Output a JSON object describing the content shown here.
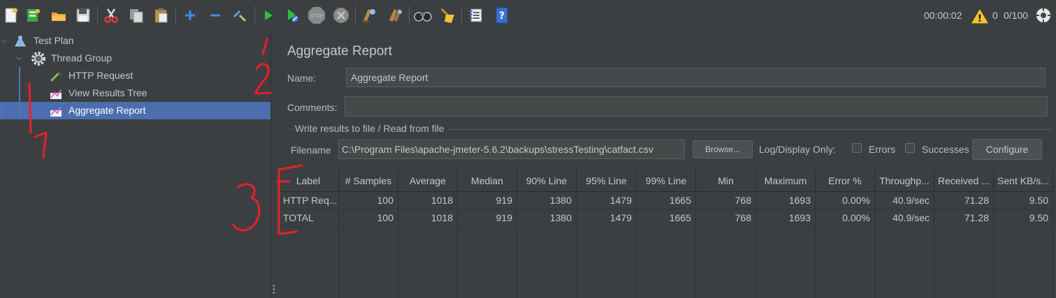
{
  "toolbar": {
    "icons": [
      "new-icon",
      "templates-icon",
      "open-icon",
      "save-icon",
      "cut-icon",
      "copy-icon",
      "paste-icon",
      "expand-icon",
      "collapse-icon",
      "toggle-icon",
      "start-icon",
      "start-no-pauses-icon",
      "stop-icon",
      "shutdown-icon",
      "clear-icon",
      "clear-all-icon",
      "search-icon",
      "reset-search-icon",
      "function-helper-icon",
      "help-icon"
    ],
    "elapsed": "00:00:02",
    "warning_count": "0",
    "threads": "0/100"
  },
  "tree": {
    "items": [
      {
        "label": "Test Plan"
      },
      {
        "label": "Thread Group"
      },
      {
        "label": "HTTP Request"
      },
      {
        "label": "View Results Tree"
      },
      {
        "label": "Aggregate Report"
      }
    ]
  },
  "panel": {
    "title": "Aggregate Report",
    "name_label": "Name:",
    "name_value": "Aggregate Report",
    "comments_label": "Comments:",
    "comments_value": "",
    "group_title": "Write results to file / Read from file",
    "filename_label": "Filename",
    "filename_value": "C:\\Program Files\\apache-jmeter-5.6.2\\backups\\stressTesting\\catfact.csv",
    "browse_label": "Browse...",
    "log_display_label": "Log/Display Only:",
    "errors_label": "Errors",
    "successes_label": "Successes",
    "configure_label": "Configure"
  },
  "table": {
    "headers": [
      "Label",
      "# Samples",
      "Average",
      "Median",
      "90% Line",
      "95% Line",
      "99% Line",
      "Min",
      "Maximum",
      "Error %",
      "Throughp...",
      "Received ...",
      "Sent KB/s..."
    ],
    "rows": [
      [
        "HTTP Req...",
        "100",
        "1018",
        "919",
        "1380",
        "1479",
        "1665",
        "768",
        "1693",
        "0.00%",
        "40.9/sec",
        "71.28",
        "9.50"
      ],
      [
        "TOTAL",
        "100",
        "1018",
        "919",
        "1380",
        "1479",
        "1665",
        "768",
        "1693",
        "0.00%",
        "40.9/sec",
        "71.28",
        "9.50"
      ]
    ]
  },
  "annotations": {
    "color": "#e8202a",
    "marks": [
      "1",
      "2",
      "3",
      "1"
    ]
  },
  "colors": {
    "background": "#3c3f41",
    "selection": "#4b6eaf",
    "tree_guide": "#4a78c2"
  }
}
